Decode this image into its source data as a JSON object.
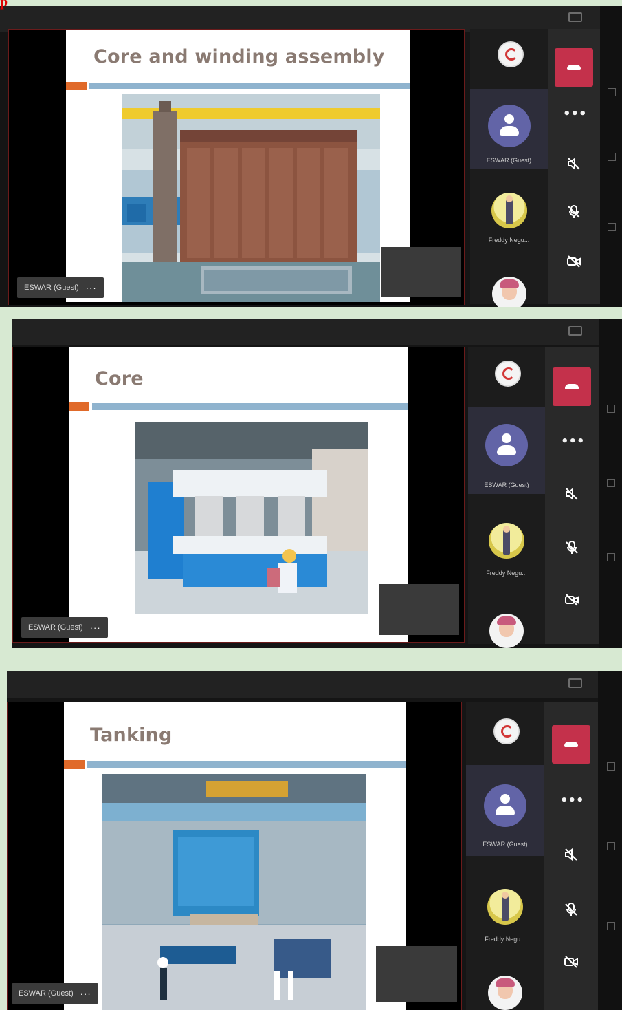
{
  "page_mark": "p",
  "panels": [
    {
      "slide_title": "Core and winding assembly",
      "self_name": "ESWAR (Guest)",
      "more_label": "···",
      "guest_name": "ESWAR (Guest)",
      "participant_name": "Freddy Negu..."
    },
    {
      "slide_title": "Core",
      "self_name": "ESWAR (Guest)",
      "more_label": "···",
      "guest_name": "ESWAR (Guest)",
      "participant_name": "Freddy Negu..."
    },
    {
      "slide_title": "Tanking",
      "self_name": "ESWAR (Guest)",
      "more_label": "···",
      "guest_name": "ESWAR (Guest)",
      "participant_name": "Freddy Negu..."
    }
  ],
  "colors": {
    "hangup": "#c4314b",
    "avatar": "#6264a7",
    "title_bar_orange": "#e06a2a",
    "title_bar_blue": "#8fb3ce"
  },
  "icons": [
    "phone-hangup-icon",
    "more-icon",
    "speaker-off-icon",
    "mic-off-icon",
    "camera-off-icon"
  ]
}
